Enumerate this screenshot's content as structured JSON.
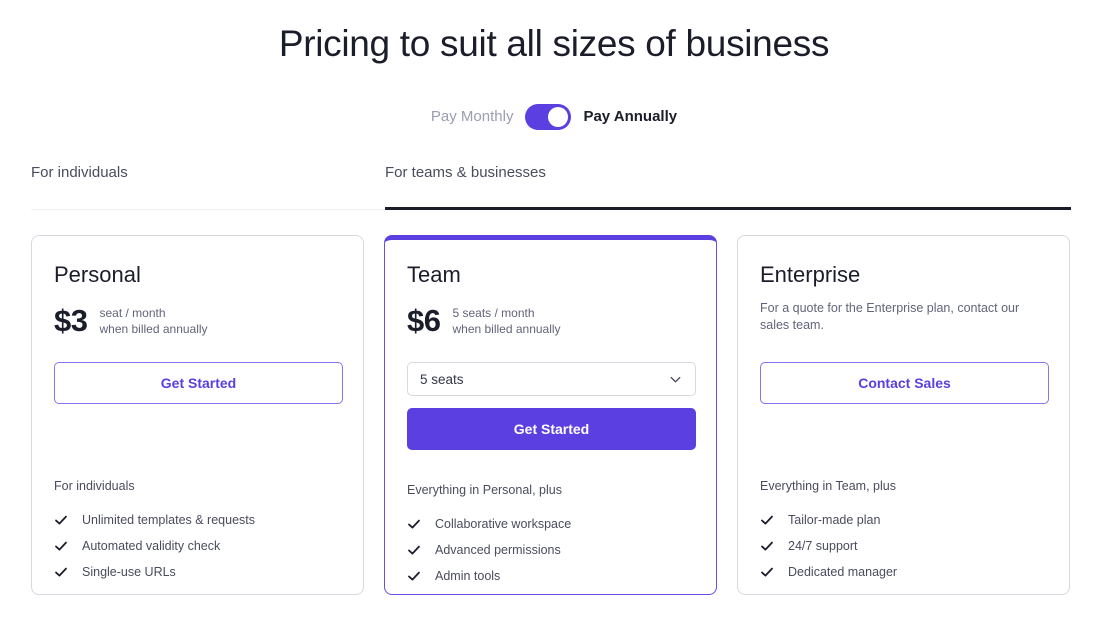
{
  "page": {
    "title": "Pricing to suit all sizes of business"
  },
  "billing": {
    "monthly_label": "Pay Monthly",
    "annually_label": "Pay Annually",
    "selected": "Pay Annually",
    "accent_color": "#5B3FE0"
  },
  "tabs": [
    {
      "label": "For individuals",
      "active": false
    },
    {
      "label": "For teams & businesses",
      "active": true
    }
  ],
  "plans": [
    {
      "name": "Personal",
      "price": "$3",
      "price_unit": "seat / month",
      "price_note": "when billed annually",
      "cta_label": "Get Started",
      "cta_style": "outline",
      "features_title": "For individuals",
      "features": [
        "Unlimited templates & requests",
        "Automated validity check",
        "Single-use URLs"
      ]
    },
    {
      "name": "Team",
      "price": "$6",
      "price_unit": "5 seats / month",
      "price_note": "when billed annually",
      "seats_select_value": "5 seats",
      "cta_label": "Get Started",
      "cta_style": "solid",
      "features_title": "Everything in Personal, plus",
      "features": [
        "Collaborative workspace",
        "Advanced permissions",
        "Admin tools"
      ],
      "highlight_color": "#5B3FE0"
    },
    {
      "name": "Enterprise",
      "description": "For a quote for the Enterprise plan, contact our sales team.",
      "cta_label": "Contact Sales",
      "cta_style": "outline",
      "features_title": "Everything in Team, plus",
      "features": [
        "Tailor-made plan",
        "24/7 support",
        "Dedicated manager"
      ]
    }
  ]
}
